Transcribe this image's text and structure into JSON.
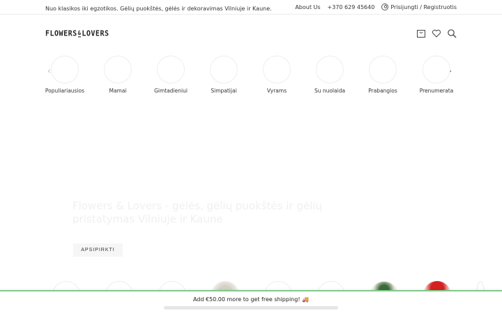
{
  "topbar": {
    "tagline": "Nuo klasikos iki egzotikos. Gėlių puokštės, gėlės ir dekoravimas Vilniuje ir Kaune.",
    "about": "About Us",
    "phone": "+370 629 45640",
    "account": "Prisijungti / Registruotis"
  },
  "header": {
    "logo_left": "FLOWERS",
    "logo_amp": "&",
    "logo_right": "LOVERS",
    "icons": [
      "cart-icon",
      "heart-icon",
      "search-icon"
    ]
  },
  "categories": [
    {
      "label": "Populiariausios"
    },
    {
      "label": "Mamai"
    },
    {
      "label": "Gimtadieniui"
    },
    {
      "label": "Simpatijai"
    },
    {
      "label": "Vyrams"
    },
    {
      "label": "Su nuolaida"
    },
    {
      "label": "Prabangios"
    },
    {
      "label": "Prenumerata"
    }
  ],
  "carousel": {
    "prev": "‹",
    "next": "›"
  },
  "hero": {
    "title": "Flowers & Lovers - gėlės, gėlių puokštės ir gėlių pristatymas Vilniuje ir Kaune",
    "button": "APSIPIRKTI"
  },
  "shipping": {
    "message": "Add €50.00 more to get free shipping! 🚚",
    "progress": 0.0
  },
  "colors": {
    "accent": "#7fc98a",
    "text": "#333333",
    "hero_title": "#f0f0f0"
  }
}
